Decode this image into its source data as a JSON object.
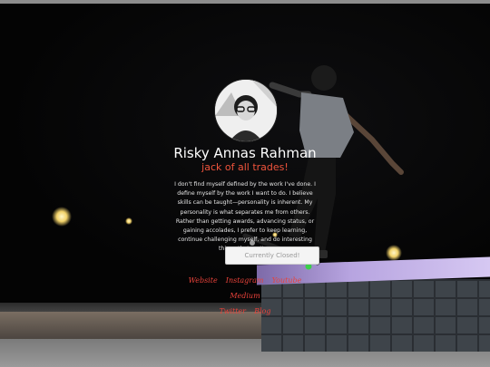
{
  "profile": {
    "name": "Risky Annas Rahman",
    "tagline": "jack of all trades!",
    "bio": "I don't find myself defined by the work I've done. I define myself by the work I want to do. I believe skills can be taught—personality is inherent. My personality is what separates me from others. Rather than getting awards, advancing status, or gaining accolades, I prefer to keep learning, continue challenging myself, and do interesting things that matter.",
    "status_button": "Currently Closed!"
  },
  "links": [
    {
      "label": "Website"
    },
    {
      "label": "Instagram"
    },
    {
      "label": "Youtube"
    },
    {
      "label": "Medium"
    },
    {
      "label": "Twitter"
    },
    {
      "label": "Blog"
    }
  ],
  "colors": {
    "accent": "#f0543c",
    "link": "#e8423a",
    "text": "#ffffff",
    "background": "#050505"
  }
}
